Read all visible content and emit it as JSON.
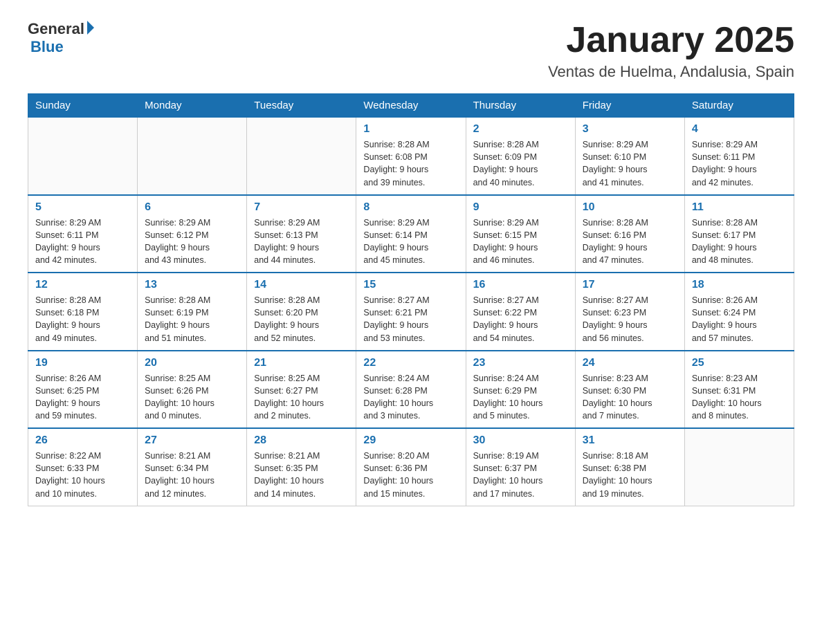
{
  "header": {
    "logo_text_general": "General",
    "logo_text_blue": "Blue",
    "main_title": "January 2025",
    "subtitle": "Ventas de Huelma, Andalusia, Spain"
  },
  "days_of_week": [
    "Sunday",
    "Monday",
    "Tuesday",
    "Wednesday",
    "Thursday",
    "Friday",
    "Saturday"
  ],
  "weeks": [
    [
      {
        "day": "",
        "info": ""
      },
      {
        "day": "",
        "info": ""
      },
      {
        "day": "",
        "info": ""
      },
      {
        "day": "1",
        "info": "Sunrise: 8:28 AM\nSunset: 6:08 PM\nDaylight: 9 hours\nand 39 minutes."
      },
      {
        "day": "2",
        "info": "Sunrise: 8:28 AM\nSunset: 6:09 PM\nDaylight: 9 hours\nand 40 minutes."
      },
      {
        "day": "3",
        "info": "Sunrise: 8:29 AM\nSunset: 6:10 PM\nDaylight: 9 hours\nand 41 minutes."
      },
      {
        "day": "4",
        "info": "Sunrise: 8:29 AM\nSunset: 6:11 PM\nDaylight: 9 hours\nand 42 minutes."
      }
    ],
    [
      {
        "day": "5",
        "info": "Sunrise: 8:29 AM\nSunset: 6:11 PM\nDaylight: 9 hours\nand 42 minutes."
      },
      {
        "day": "6",
        "info": "Sunrise: 8:29 AM\nSunset: 6:12 PM\nDaylight: 9 hours\nand 43 minutes."
      },
      {
        "day": "7",
        "info": "Sunrise: 8:29 AM\nSunset: 6:13 PM\nDaylight: 9 hours\nand 44 minutes."
      },
      {
        "day": "8",
        "info": "Sunrise: 8:29 AM\nSunset: 6:14 PM\nDaylight: 9 hours\nand 45 minutes."
      },
      {
        "day": "9",
        "info": "Sunrise: 8:29 AM\nSunset: 6:15 PM\nDaylight: 9 hours\nand 46 minutes."
      },
      {
        "day": "10",
        "info": "Sunrise: 8:28 AM\nSunset: 6:16 PM\nDaylight: 9 hours\nand 47 minutes."
      },
      {
        "day": "11",
        "info": "Sunrise: 8:28 AM\nSunset: 6:17 PM\nDaylight: 9 hours\nand 48 minutes."
      }
    ],
    [
      {
        "day": "12",
        "info": "Sunrise: 8:28 AM\nSunset: 6:18 PM\nDaylight: 9 hours\nand 49 minutes."
      },
      {
        "day": "13",
        "info": "Sunrise: 8:28 AM\nSunset: 6:19 PM\nDaylight: 9 hours\nand 51 minutes."
      },
      {
        "day": "14",
        "info": "Sunrise: 8:28 AM\nSunset: 6:20 PM\nDaylight: 9 hours\nand 52 minutes."
      },
      {
        "day": "15",
        "info": "Sunrise: 8:27 AM\nSunset: 6:21 PM\nDaylight: 9 hours\nand 53 minutes."
      },
      {
        "day": "16",
        "info": "Sunrise: 8:27 AM\nSunset: 6:22 PM\nDaylight: 9 hours\nand 54 minutes."
      },
      {
        "day": "17",
        "info": "Sunrise: 8:27 AM\nSunset: 6:23 PM\nDaylight: 9 hours\nand 56 minutes."
      },
      {
        "day": "18",
        "info": "Sunrise: 8:26 AM\nSunset: 6:24 PM\nDaylight: 9 hours\nand 57 minutes."
      }
    ],
    [
      {
        "day": "19",
        "info": "Sunrise: 8:26 AM\nSunset: 6:25 PM\nDaylight: 9 hours\nand 59 minutes."
      },
      {
        "day": "20",
        "info": "Sunrise: 8:25 AM\nSunset: 6:26 PM\nDaylight: 10 hours\nand 0 minutes."
      },
      {
        "day": "21",
        "info": "Sunrise: 8:25 AM\nSunset: 6:27 PM\nDaylight: 10 hours\nand 2 minutes."
      },
      {
        "day": "22",
        "info": "Sunrise: 8:24 AM\nSunset: 6:28 PM\nDaylight: 10 hours\nand 3 minutes."
      },
      {
        "day": "23",
        "info": "Sunrise: 8:24 AM\nSunset: 6:29 PM\nDaylight: 10 hours\nand 5 minutes."
      },
      {
        "day": "24",
        "info": "Sunrise: 8:23 AM\nSunset: 6:30 PM\nDaylight: 10 hours\nand 7 minutes."
      },
      {
        "day": "25",
        "info": "Sunrise: 8:23 AM\nSunset: 6:31 PM\nDaylight: 10 hours\nand 8 minutes."
      }
    ],
    [
      {
        "day": "26",
        "info": "Sunrise: 8:22 AM\nSunset: 6:33 PM\nDaylight: 10 hours\nand 10 minutes."
      },
      {
        "day": "27",
        "info": "Sunrise: 8:21 AM\nSunset: 6:34 PM\nDaylight: 10 hours\nand 12 minutes."
      },
      {
        "day": "28",
        "info": "Sunrise: 8:21 AM\nSunset: 6:35 PM\nDaylight: 10 hours\nand 14 minutes."
      },
      {
        "day": "29",
        "info": "Sunrise: 8:20 AM\nSunset: 6:36 PM\nDaylight: 10 hours\nand 15 minutes."
      },
      {
        "day": "30",
        "info": "Sunrise: 8:19 AM\nSunset: 6:37 PM\nDaylight: 10 hours\nand 17 minutes."
      },
      {
        "day": "31",
        "info": "Sunrise: 8:18 AM\nSunset: 6:38 PM\nDaylight: 10 hours\nand 19 minutes."
      },
      {
        "day": "",
        "info": ""
      }
    ]
  ]
}
